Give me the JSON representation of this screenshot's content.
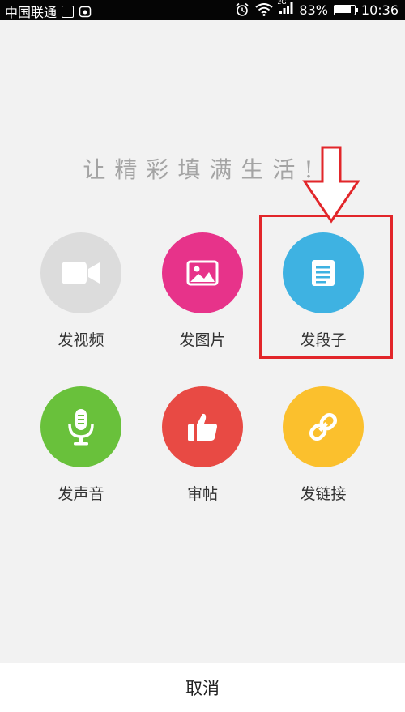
{
  "status_bar": {
    "carrier": "中国联通",
    "network": "2G",
    "battery_percent_text": "83%",
    "battery_level": 0.83,
    "time": "10:36"
  },
  "tagline": "让精彩填满生活!",
  "actions": [
    {
      "label": "发视频",
      "icon": "video-camera-icon",
      "color": "#dcdcdc"
    },
    {
      "label": "发图片",
      "icon": "image-icon",
      "color": "#e7338a"
    },
    {
      "label": "发段子",
      "icon": "document-icon",
      "color": "#3eb2e2"
    },
    {
      "label": "发声音",
      "icon": "microphone-icon",
      "color": "#69c13b"
    },
    {
      "label": "审帖",
      "icon": "thumbs-up-icon",
      "color": "#e84a44"
    },
    {
      "label": "发链接",
      "icon": "link-icon",
      "color": "#fbc02d"
    }
  ],
  "highlight_color": "#e2262a",
  "cancel_label": "取消"
}
